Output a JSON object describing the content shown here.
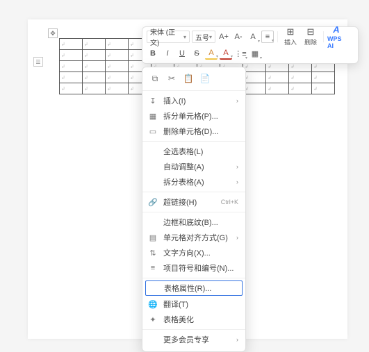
{
  "toolbar": {
    "font_family": "宋体 (正文)",
    "font_size": "五号",
    "btn_bold": "B",
    "btn_italic": "I",
    "btn_underline": "U",
    "btn_strike": "S",
    "btn_inc_font": "A+",
    "btn_dec_font": "A-",
    "btn_clear": "A",
    "btn_highlight": "A",
    "btn_font_color": "A",
    "btn_align": "≡",
    "btn_list": "⋮≡",
    "insert": {
      "icon": "⊞",
      "label": "插入"
    },
    "delete": {
      "icon": "⊟",
      "label": "删除"
    },
    "ai": {
      "icon": "A",
      "label": "WPS AI"
    }
  },
  "context_menu": {
    "top_icons": [
      "copy-icon",
      "cut-icon",
      "paste-icon",
      "paste-special-icon"
    ],
    "items": [
      {
        "icon": "↧",
        "label": "插入(I)",
        "arrow": true
      },
      {
        "icon": "▦",
        "label": "拆分单元格(P)..."
      },
      {
        "icon": "▭",
        "label": "删除单元格(D)..."
      },
      {
        "sep": true
      },
      {
        "indent": true,
        "label": "全选表格(L)"
      },
      {
        "indent": true,
        "label": "自动调整(A)",
        "arrow": true
      },
      {
        "indent": true,
        "label": "拆分表格(A)",
        "arrow": true
      },
      {
        "sep": true
      },
      {
        "icon": "🔗",
        "label": "超链接(H)",
        "shortcut": "Ctrl+K"
      },
      {
        "sep": true
      },
      {
        "indent": true,
        "label": "边框和底纹(B)..."
      },
      {
        "icon": "▤",
        "label": "单元格对齐方式(G)",
        "arrow": true
      },
      {
        "icon": "⇅",
        "label": "文字方向(X)..."
      },
      {
        "icon": "≡",
        "label": "项目符号和编号(N)..."
      },
      {
        "sep": true
      },
      {
        "highlight": true,
        "label": "表格属性(R)..."
      },
      {
        "icon": "🌐",
        "label": "翻译(T)"
      },
      {
        "icon": "✦",
        "label": "表格美化"
      },
      {
        "sep": true
      },
      {
        "indent": true,
        "label": "更多会员专享",
        "arrow": true
      }
    ]
  },
  "table": {
    "rows": 5,
    "cols": 12
  }
}
